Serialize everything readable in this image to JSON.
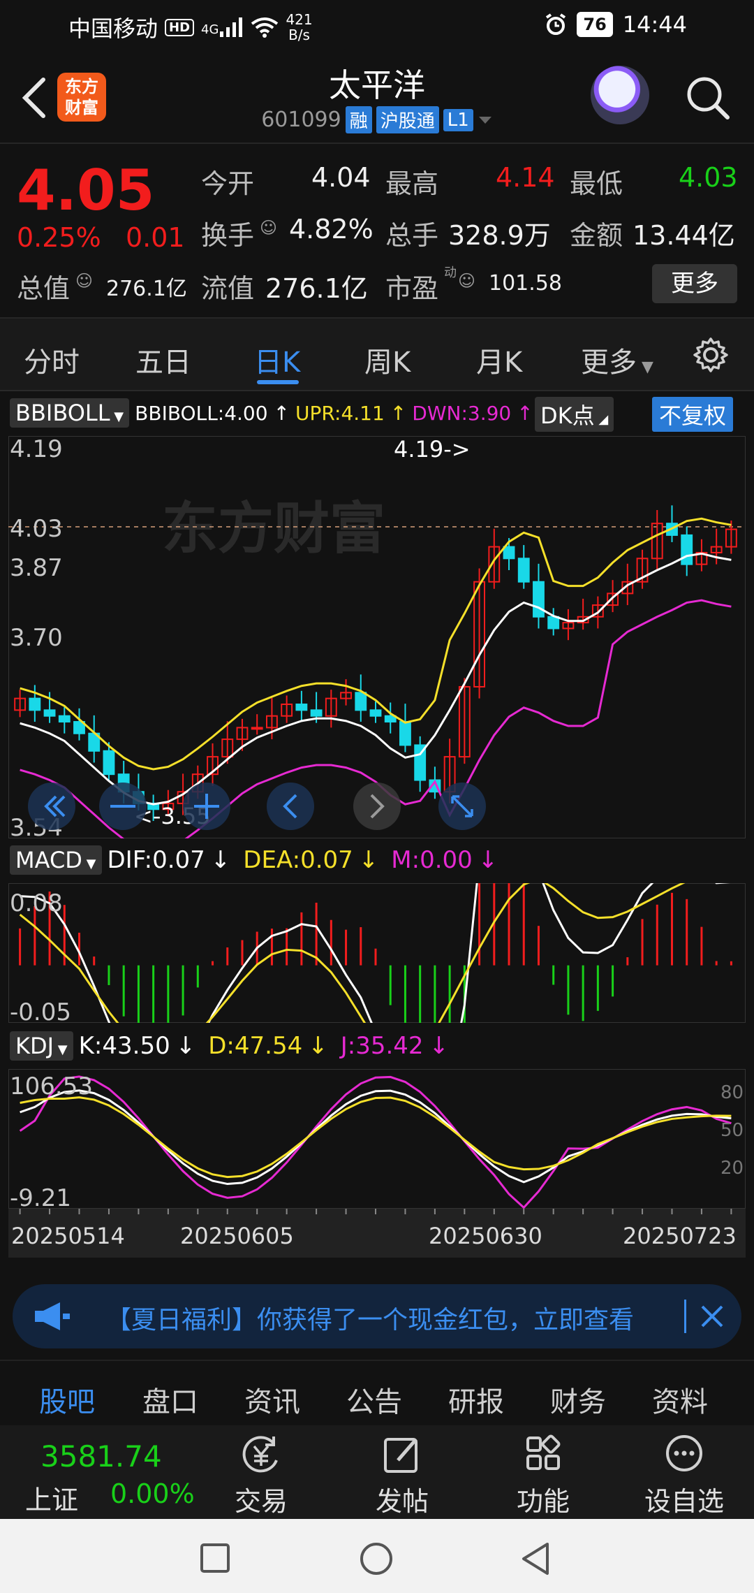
{
  "status": {
    "carrier": "中国移动",
    "hd": "HD",
    "signal": "4G",
    "speed_top": "421",
    "speed_bottom": "B/s",
    "battery": "76",
    "time": "14:44"
  },
  "header": {
    "logo_line1": "东方",
    "logo_line2": "财富",
    "title": "太平洋",
    "code": "601099",
    "tags": [
      "融",
      "沪股通",
      "L1"
    ]
  },
  "quote": {
    "price": "4.05",
    "pct": "0.25%",
    "change": "0.01",
    "open_label": "今开",
    "open": "4.04",
    "high_label": "最高",
    "high": "4.14",
    "low_label": "最低",
    "low": "4.03",
    "turnover_label": "换手",
    "turnover": "4.82%",
    "volume_label": "总手",
    "volume": "328.9万",
    "amount_label": "金额",
    "amount": "13.44亿",
    "mcap_label": "总值",
    "mcap": "276.1亿",
    "float_label": "流值",
    "float": "276.1亿",
    "pe_label": "市盈",
    "pe_sup": "动",
    "pe": "101.58",
    "more": "更多"
  },
  "period_tabs": [
    "分时",
    "五日",
    "日K",
    "周K",
    "月K",
    "更多"
  ],
  "active_period": "日K",
  "chart": {
    "main_indicator": "BBIBOLL",
    "bbiboll_text": "BBIBOLL:4.00",
    "upr_text": "UPR:4.11",
    "dwn_text": "DWN:3.90",
    "dk_button": "DK点",
    "adjust_button": "不复权",
    "y_labels": [
      "4.19",
      "4.03",
      "3.87",
      "3.70",
      "3.54"
    ],
    "high_marker": "4.19->",
    "low_marker": "<-3.55",
    "watermark": "东方财富",
    "macd_name": "MACD",
    "dif_text": "DIF:0.07",
    "dea_text": "DEA:0.07",
    "m_text": "M:0.00",
    "macd_y": [
      "0.08",
      "-0.05"
    ],
    "kdj_name": "KDJ",
    "k_text": "K:43.50",
    "d_text": "D:47.54",
    "j_text": "J:35.42",
    "kdj_y": [
      "106.53",
      "-9.21"
    ],
    "kdj_right": [
      "80",
      "50",
      "20"
    ],
    "dates": [
      "20250514",
      "20250605",
      "20250630",
      "20250723"
    ],
    "colors": {
      "up": "#f21d1d",
      "down": "#19d8e8",
      "upr": "#f5e02a",
      "mid": "#ffffff",
      "dwn": "#e62ad2"
    }
  },
  "banner": {
    "text": "【夏日福利】你获得了一个现金红包，立即查看"
  },
  "bottom_tabs": [
    "股吧",
    "盘口",
    "资讯",
    "公告",
    "研报",
    "财务",
    "资料"
  ],
  "active_bottom": "股吧",
  "toolbar": {
    "index_value": "3581.74",
    "index_name": "上证",
    "index_pct": "0.00%",
    "items": [
      "交易",
      "发帖",
      "功能",
      "设自选"
    ]
  }
}
